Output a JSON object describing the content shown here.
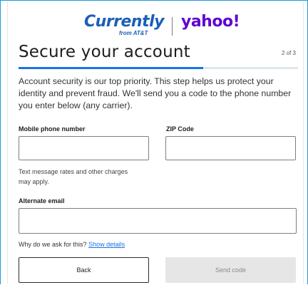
{
  "brand": {
    "currently": "Currently",
    "from_att": "from AT&T",
    "yahoo": "yahoo!",
    "colors": {
      "currently": "#1b5fb8",
      "yahoo": "#6001d2",
      "accent": "#1a73e8"
    }
  },
  "header": {
    "title": "Secure your account",
    "step": "2 of 3",
    "progress": 0.66
  },
  "description": "Account security is our top priority. This step helps us protect your identity and prevent fraud. We'll send you a code to the phone number you enter below (any carrier).",
  "form": {
    "mobile_label": "Mobile phone number",
    "mobile_value": "",
    "zip_label": "ZIP Code",
    "zip_value": "",
    "rates_note": "Text message rates and other charges may apply.",
    "alt_email_label": "Alternate email",
    "alt_email_value": "",
    "why_text": "Why do we ask for this?",
    "show_details": "Show details"
  },
  "actions": {
    "back": "Back",
    "send_code": "Send code"
  }
}
